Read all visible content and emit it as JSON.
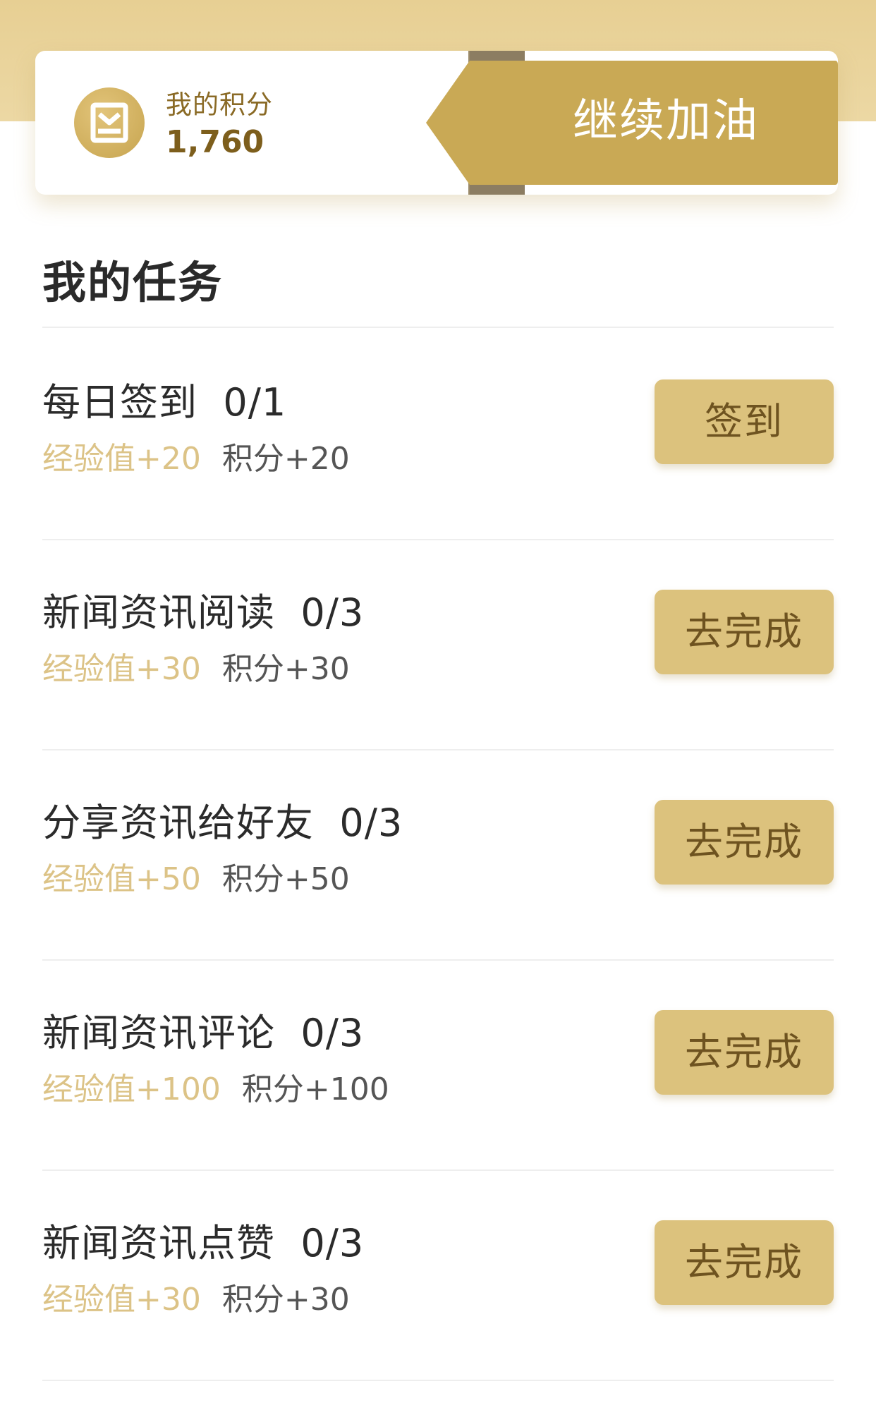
{
  "points_card": {
    "label": "我的积分",
    "value": "1,760",
    "icon": "coin-icon"
  },
  "cheer_button": {
    "label": "继续加油"
  },
  "section": {
    "title": "我的任务"
  },
  "tasks": [
    {
      "name": "每日签到",
      "progress": "0/1",
      "exp": "经验值+20",
      "points": "积分+20",
      "button": "签到"
    },
    {
      "name": "新闻资讯阅读",
      "progress": "0/3",
      "exp": "经验值+30",
      "points": "积分+30",
      "button": "去完成"
    },
    {
      "name": "分享资讯给好友",
      "progress": "0/3",
      "exp": "经验值+50",
      "points": "积分+50",
      "button": "去完成"
    },
    {
      "name": "新闻资讯评论",
      "progress": "0/3",
      "exp": "经验值+100",
      "points": "积分+100",
      "button": "去完成"
    },
    {
      "name": "新闻资讯点赞",
      "progress": "0/3",
      "exp": "经验值+30",
      "points": "积分+30",
      "button": "去完成"
    }
  ],
  "colors": {
    "gold_band": "#e7cf93",
    "gold_button": "#dcc27d",
    "gold_ribbon": "#c9a955",
    "exp_text": "#dcc387",
    "title_text": "#2a2a2a"
  }
}
